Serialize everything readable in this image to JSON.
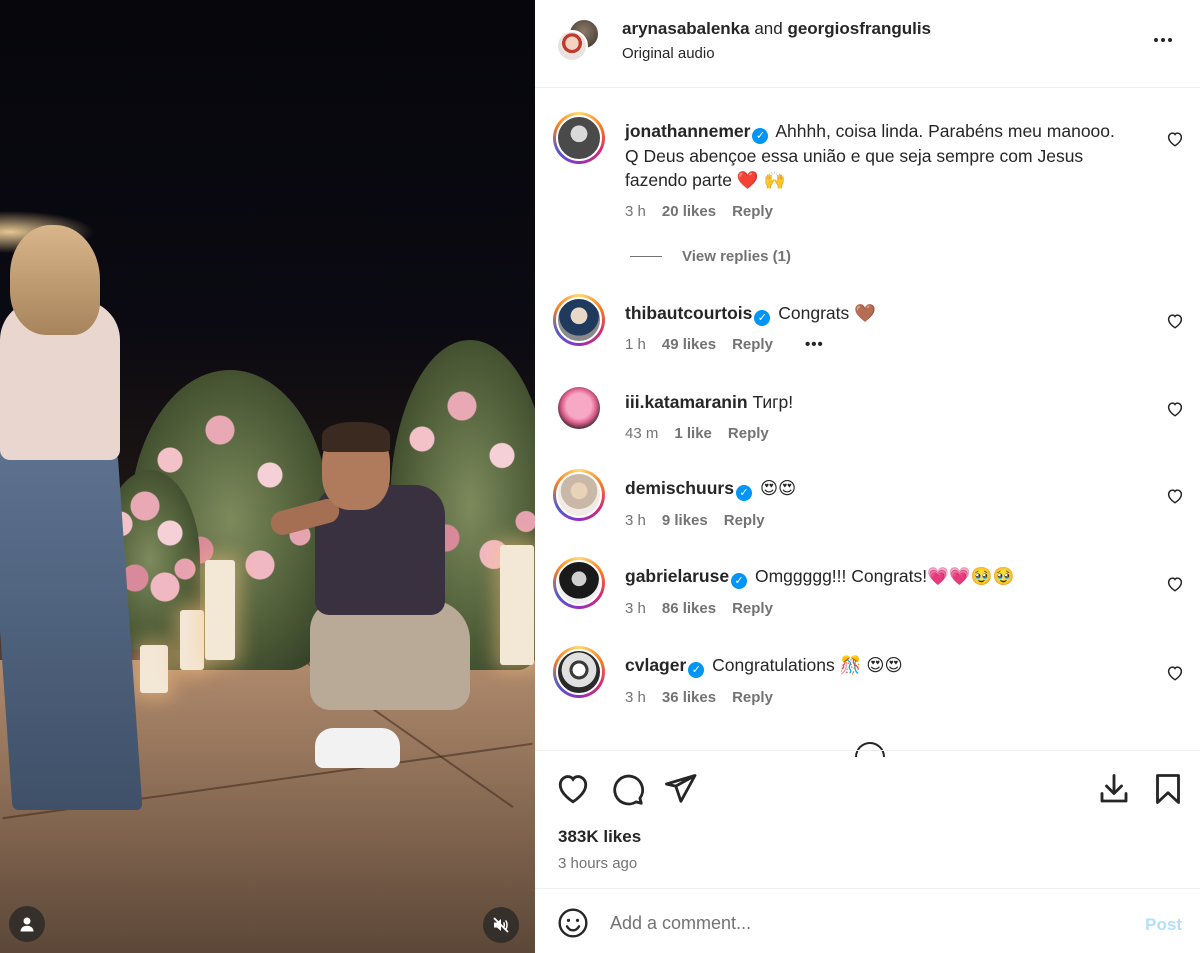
{
  "header": {
    "user1": "arynasabalenka",
    "joiner": "and",
    "user2": "georgiosfrangulis",
    "audio": "Original audio"
  },
  "comments": [
    {
      "user": "jonathannemer",
      "verified": true,
      "text_line1": "Ahhhh, coisa linda. Parabéns meu manooo.",
      "text_line2": "Q Deus abençoe essa união e que seja sempre com Jesus",
      "text_line3": "fazendo parte ❤️ 🙌",
      "time": "3 h",
      "likes": "20 likes",
      "reply": "Reply",
      "view_replies": "View replies (1)"
    },
    {
      "user": "thibautcourtois",
      "verified": true,
      "text": "Congrats 🤎",
      "time": "1 h",
      "likes": "49 likes",
      "reply": "Reply",
      "more": "•••"
    },
    {
      "user": "iii.katamaranin",
      "verified": false,
      "text": "Тигр!",
      "time": "43 m",
      "likes": "1 like",
      "reply": "Reply"
    },
    {
      "user": "demischuurs",
      "verified": true,
      "text": "😍😍",
      "time": "3 h",
      "likes": "9 likes",
      "reply": "Reply"
    },
    {
      "user": "gabrielaruse",
      "verified": true,
      "text": "Omggggg!!! Congrats!💗💗🥹🥹",
      "time": "3 h",
      "likes": "86 likes",
      "reply": "Reply"
    },
    {
      "user": "cvlager",
      "verified": true,
      "text": "Congratulations 🎊 😍😍",
      "time": "3 h",
      "likes": "36 likes",
      "reply": "Reply"
    }
  ],
  "post": {
    "likes": "383K likes",
    "time_ago": "3 hours ago"
  },
  "add_comment": {
    "placeholder": "Add a comment...",
    "post_label": "Post"
  },
  "icons": {
    "more": "more-options-icon",
    "like": "heart-icon",
    "comment": "comment-icon",
    "share": "send-icon",
    "download": "download-icon",
    "save": "bookmark-icon",
    "emoji": "emoji-icon",
    "tagged_users": "user-icon",
    "mute": "muted-audio-icon"
  },
  "colors": {
    "link_blue": "#0095f6",
    "post_disabled": "#b2dffc",
    "secondary_text": "#737373"
  }
}
